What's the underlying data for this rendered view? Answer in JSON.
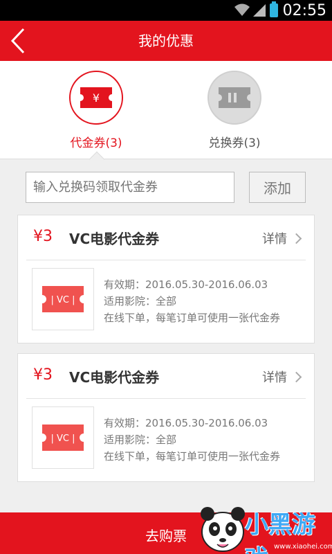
{
  "status_bar": {
    "time": "02:55"
  },
  "header": {
    "title": "我的优惠"
  },
  "tabs": [
    {
      "label": "代金券(3)",
      "icon": "voucher-icon",
      "active": true
    },
    {
      "label": "兑换券(3)",
      "icon": "exchange-ticket-icon",
      "active": false
    }
  ],
  "redeem": {
    "placeholder": "输入兑换码领取代金券",
    "button_label": "添加"
  },
  "vouchers": [
    {
      "amount": "¥3",
      "name": "VC电影代金券",
      "details_label": "详情",
      "thumb_text": "| VC |",
      "validity": "有效期：2016.05.30-2016.06.03",
      "cinemas": "适用影院：全部",
      "usage": "在线下单，每笔订单可使用一张代金券"
    },
    {
      "amount": "¥3",
      "name": "VC电影代金券",
      "details_label": "详情",
      "thumb_text": "| VC |",
      "validity": "有效期：2016.05.30-2016.06.03",
      "cinemas": "适用影院：全部",
      "usage": "在线下单，每笔订单可使用一张代金券"
    }
  ],
  "footer": {
    "button_label": "去购票"
  },
  "watermark": {
    "text": "小黑游戏",
    "url": "www.xiaohei.com"
  },
  "colors": {
    "brand_red": "#e3141e",
    "background": "#efefef",
    "text_gray": "#777777"
  }
}
